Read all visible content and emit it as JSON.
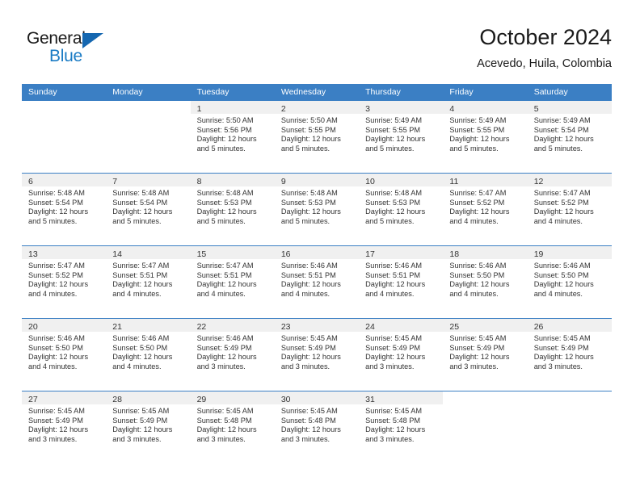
{
  "brand": {
    "name_part1": "General",
    "name_part2": "Blue",
    "accent_color": "#1a7bc4",
    "triangle_color": "#1567b0"
  },
  "header": {
    "title": "October 2024",
    "location": "Acevedo, Huila, Colombia"
  },
  "calendar": {
    "header_bg": "#3b7fc4",
    "daynum_band_bg": "#f0f0f0",
    "weekdays": [
      "Sunday",
      "Monday",
      "Tuesday",
      "Wednesday",
      "Thursday",
      "Friday",
      "Saturday"
    ],
    "weeks": [
      [
        {
          "day": "",
          "lines": []
        },
        {
          "day": "",
          "lines": []
        },
        {
          "day": "1",
          "lines": [
            "Sunrise: 5:50 AM",
            "Sunset: 5:56 PM",
            "Daylight: 12 hours",
            "and 5 minutes."
          ]
        },
        {
          "day": "2",
          "lines": [
            "Sunrise: 5:50 AM",
            "Sunset: 5:55 PM",
            "Daylight: 12 hours",
            "and 5 minutes."
          ]
        },
        {
          "day": "3",
          "lines": [
            "Sunrise: 5:49 AM",
            "Sunset: 5:55 PM",
            "Daylight: 12 hours",
            "and 5 minutes."
          ]
        },
        {
          "day": "4",
          "lines": [
            "Sunrise: 5:49 AM",
            "Sunset: 5:55 PM",
            "Daylight: 12 hours",
            "and 5 minutes."
          ]
        },
        {
          "day": "5",
          "lines": [
            "Sunrise: 5:49 AM",
            "Sunset: 5:54 PM",
            "Daylight: 12 hours",
            "and 5 minutes."
          ]
        }
      ],
      [
        {
          "day": "6",
          "lines": [
            "Sunrise: 5:48 AM",
            "Sunset: 5:54 PM",
            "Daylight: 12 hours",
            "and 5 minutes."
          ]
        },
        {
          "day": "7",
          "lines": [
            "Sunrise: 5:48 AM",
            "Sunset: 5:54 PM",
            "Daylight: 12 hours",
            "and 5 minutes."
          ]
        },
        {
          "day": "8",
          "lines": [
            "Sunrise: 5:48 AM",
            "Sunset: 5:53 PM",
            "Daylight: 12 hours",
            "and 5 minutes."
          ]
        },
        {
          "day": "9",
          "lines": [
            "Sunrise: 5:48 AM",
            "Sunset: 5:53 PM",
            "Daylight: 12 hours",
            "and 5 minutes."
          ]
        },
        {
          "day": "10",
          "lines": [
            "Sunrise: 5:48 AM",
            "Sunset: 5:53 PM",
            "Daylight: 12 hours",
            "and 5 minutes."
          ]
        },
        {
          "day": "11",
          "lines": [
            "Sunrise: 5:47 AM",
            "Sunset: 5:52 PM",
            "Daylight: 12 hours",
            "and 4 minutes."
          ]
        },
        {
          "day": "12",
          "lines": [
            "Sunrise: 5:47 AM",
            "Sunset: 5:52 PM",
            "Daylight: 12 hours",
            "and 4 minutes."
          ]
        }
      ],
      [
        {
          "day": "13",
          "lines": [
            "Sunrise: 5:47 AM",
            "Sunset: 5:52 PM",
            "Daylight: 12 hours",
            "and 4 minutes."
          ]
        },
        {
          "day": "14",
          "lines": [
            "Sunrise: 5:47 AM",
            "Sunset: 5:51 PM",
            "Daylight: 12 hours",
            "and 4 minutes."
          ]
        },
        {
          "day": "15",
          "lines": [
            "Sunrise: 5:47 AM",
            "Sunset: 5:51 PM",
            "Daylight: 12 hours",
            "and 4 minutes."
          ]
        },
        {
          "day": "16",
          "lines": [
            "Sunrise: 5:46 AM",
            "Sunset: 5:51 PM",
            "Daylight: 12 hours",
            "and 4 minutes."
          ]
        },
        {
          "day": "17",
          "lines": [
            "Sunrise: 5:46 AM",
            "Sunset: 5:51 PM",
            "Daylight: 12 hours",
            "and 4 minutes."
          ]
        },
        {
          "day": "18",
          "lines": [
            "Sunrise: 5:46 AM",
            "Sunset: 5:50 PM",
            "Daylight: 12 hours",
            "and 4 minutes."
          ]
        },
        {
          "day": "19",
          "lines": [
            "Sunrise: 5:46 AM",
            "Sunset: 5:50 PM",
            "Daylight: 12 hours",
            "and 4 minutes."
          ]
        }
      ],
      [
        {
          "day": "20",
          "lines": [
            "Sunrise: 5:46 AM",
            "Sunset: 5:50 PM",
            "Daylight: 12 hours",
            "and 4 minutes."
          ]
        },
        {
          "day": "21",
          "lines": [
            "Sunrise: 5:46 AM",
            "Sunset: 5:50 PM",
            "Daylight: 12 hours",
            "and 4 minutes."
          ]
        },
        {
          "day": "22",
          "lines": [
            "Sunrise: 5:46 AM",
            "Sunset: 5:49 PM",
            "Daylight: 12 hours",
            "and 3 minutes."
          ]
        },
        {
          "day": "23",
          "lines": [
            "Sunrise: 5:45 AM",
            "Sunset: 5:49 PM",
            "Daylight: 12 hours",
            "and 3 minutes."
          ]
        },
        {
          "day": "24",
          "lines": [
            "Sunrise: 5:45 AM",
            "Sunset: 5:49 PM",
            "Daylight: 12 hours",
            "and 3 minutes."
          ]
        },
        {
          "day": "25",
          "lines": [
            "Sunrise: 5:45 AM",
            "Sunset: 5:49 PM",
            "Daylight: 12 hours",
            "and 3 minutes."
          ]
        },
        {
          "day": "26",
          "lines": [
            "Sunrise: 5:45 AM",
            "Sunset: 5:49 PM",
            "Daylight: 12 hours",
            "and 3 minutes."
          ]
        }
      ],
      [
        {
          "day": "27",
          "lines": [
            "Sunrise: 5:45 AM",
            "Sunset: 5:49 PM",
            "Daylight: 12 hours",
            "and 3 minutes."
          ]
        },
        {
          "day": "28",
          "lines": [
            "Sunrise: 5:45 AM",
            "Sunset: 5:49 PM",
            "Daylight: 12 hours",
            "and 3 minutes."
          ]
        },
        {
          "day": "29",
          "lines": [
            "Sunrise: 5:45 AM",
            "Sunset: 5:48 PM",
            "Daylight: 12 hours",
            "and 3 minutes."
          ]
        },
        {
          "day": "30",
          "lines": [
            "Sunrise: 5:45 AM",
            "Sunset: 5:48 PM",
            "Daylight: 12 hours",
            "and 3 minutes."
          ]
        },
        {
          "day": "31",
          "lines": [
            "Sunrise: 5:45 AM",
            "Sunset: 5:48 PM",
            "Daylight: 12 hours",
            "and 3 minutes."
          ]
        },
        {
          "day": "",
          "lines": []
        },
        {
          "day": "",
          "lines": []
        }
      ]
    ]
  }
}
